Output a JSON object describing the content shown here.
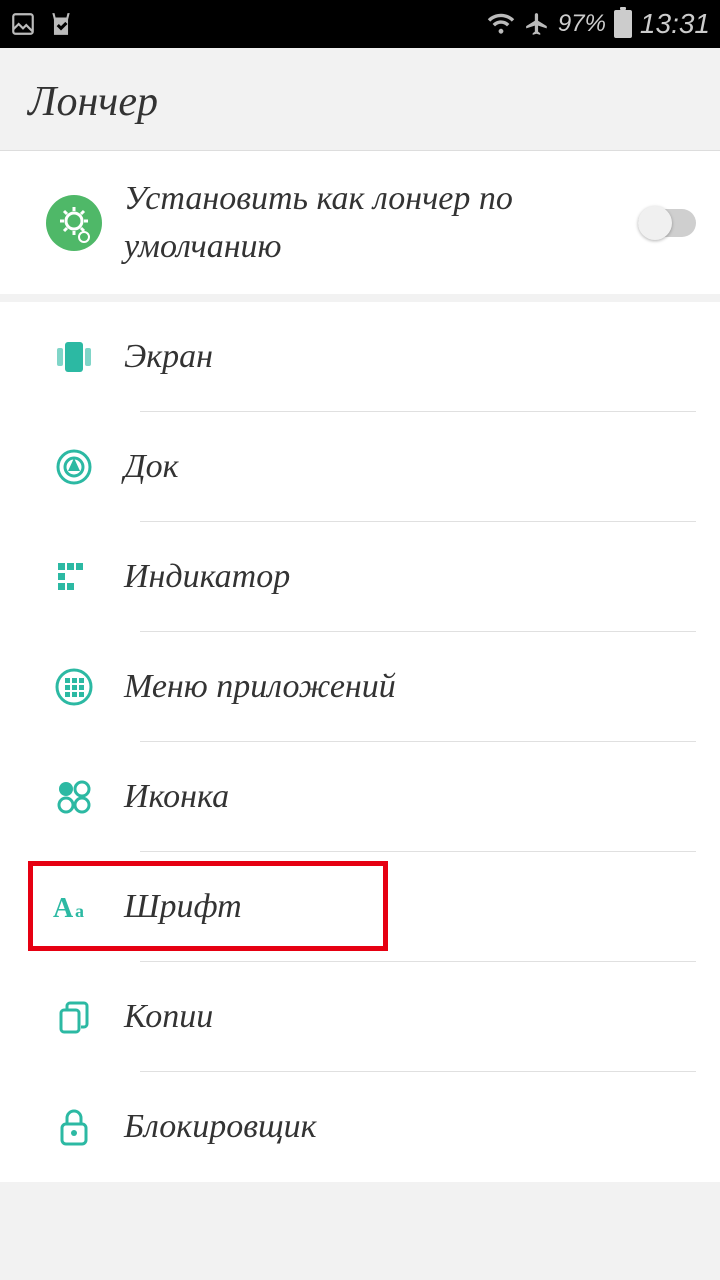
{
  "status": {
    "battery_pct": "97%",
    "time": "13:31"
  },
  "header": {
    "title": "Лончер"
  },
  "default_row": {
    "label": "Установить как лончер по умолчанию",
    "toggle": false
  },
  "items": [
    {
      "label": "Экран"
    },
    {
      "label": "Док"
    },
    {
      "label": "Индикатор"
    },
    {
      "label": "Меню приложений"
    },
    {
      "label": "Иконка"
    },
    {
      "label": "Шрифт"
    },
    {
      "label": "Копии"
    },
    {
      "label": "Блокировщик"
    }
  ],
  "highlighted_index": 5,
  "accent": "#2cb9a3"
}
